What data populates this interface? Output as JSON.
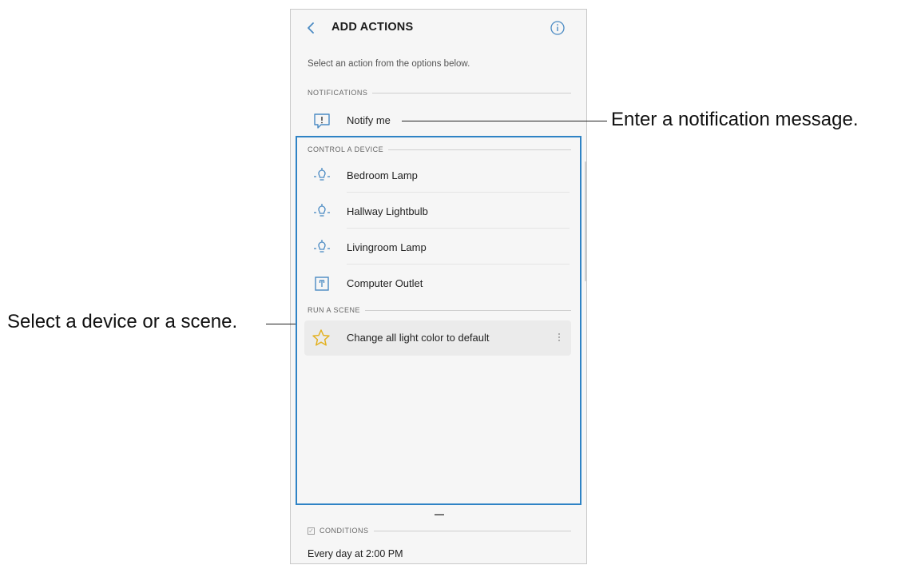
{
  "screen": {
    "title": "ADD ACTIONS",
    "back_icon": "chevron-left-icon",
    "info_icon": "info-circle-icon",
    "instruction": "Select an action from the options below."
  },
  "sections": {
    "notifications": {
      "header": "NOTIFICATIONS",
      "items": [
        {
          "label": "Notify me",
          "icon": "notification-message-icon"
        }
      ]
    },
    "control_device": {
      "header": "CONTROL A DEVICE",
      "items": [
        {
          "label": "Bedroom Lamp",
          "icon": "lightbulb-icon"
        },
        {
          "label": "Hallway Lightbulb",
          "icon": "lightbulb-icon"
        },
        {
          "label": "Livingroom Lamp",
          "icon": "lightbulb-icon"
        },
        {
          "label": "Computer Outlet",
          "icon": "power-outlet-icon"
        }
      ]
    },
    "run_scene": {
      "header": "RUN A SCENE",
      "items": [
        {
          "label": "Change all light color to default",
          "icon": "star-icon",
          "menu_icon": "more-vertical-icon"
        }
      ]
    }
  },
  "conditions": {
    "header": "CONDITIONS",
    "checkbox_icon": "checkbox-icon",
    "value": "Every day at 2:00 PM"
  },
  "callouts": {
    "notification": "Enter a notification message.",
    "device_scene": "Select a device or a scene."
  },
  "colors": {
    "highlight": "#2f83c5",
    "icon_blue": "#4a8ac3",
    "star": "#e3b224",
    "screen_bg": "#f6f6f6"
  }
}
